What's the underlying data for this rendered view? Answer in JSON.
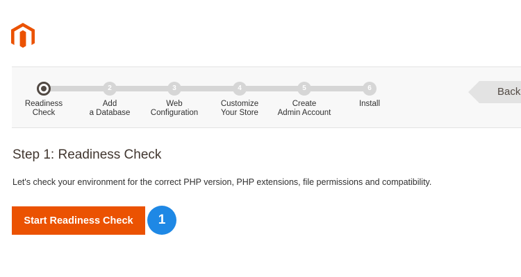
{
  "brand": {
    "logo_icon": "magento-logo-icon",
    "accent": "#eb5202"
  },
  "wizard": {
    "steps": [
      {
        "number": "1",
        "label": "Readiness\nCheck",
        "active": true
      },
      {
        "number": "2",
        "label": "Add\na Database",
        "active": false
      },
      {
        "number": "3",
        "label": "Web\nConfiguration",
        "active": false
      },
      {
        "number": "4",
        "label": "Customize\nYour Store",
        "active": false
      },
      {
        "number": "5",
        "label": "Create\nAdmin Account",
        "active": false
      },
      {
        "number": "6",
        "label": "Install",
        "active": false
      }
    ],
    "back_label": "Back"
  },
  "main": {
    "title": "Step 1: Readiness Check",
    "description": "Let's check your environment for the correct PHP version, PHP extensions, file permissions and compatibility.",
    "start_button_label": "Start Readiness Check",
    "callout_number": "1",
    "callout_color": "#1e88e5"
  }
}
